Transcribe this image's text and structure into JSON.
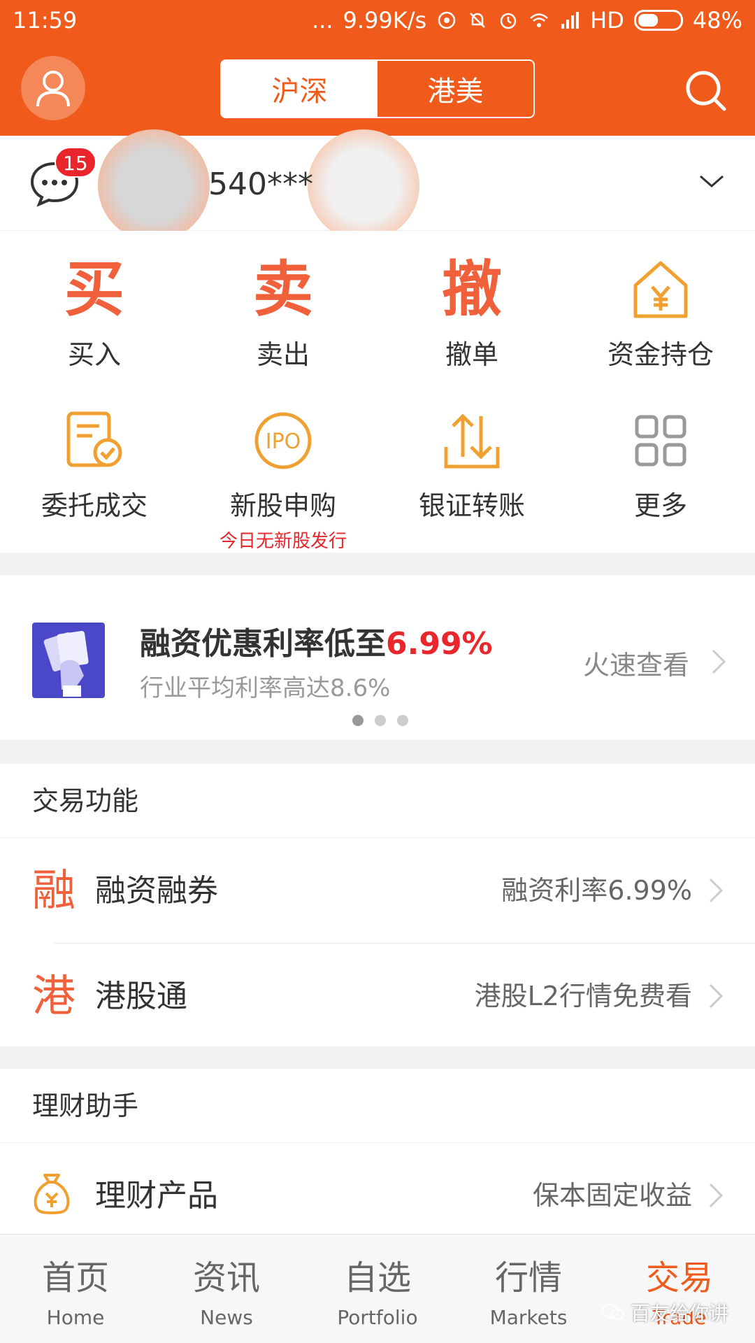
{
  "status_bar": {
    "time": "11:59",
    "dots": "...",
    "network_speed": "9.99K/s",
    "hd": "HD",
    "battery": "48%",
    "battery_level": 0.48
  },
  "header": {
    "tabs": [
      {
        "label": "沪深",
        "active": true
      },
      {
        "label": "港美",
        "active": false
      }
    ]
  },
  "account": {
    "message_badge": "15",
    "account_number": "540***"
  },
  "quick_actions": [
    {
      "glyph": "买",
      "label": "买入"
    },
    {
      "glyph": "卖",
      "label": "卖出"
    },
    {
      "glyph": "撤",
      "label": "撤单"
    },
    {
      "icon": "money-house-icon",
      "label": "资金持仓"
    },
    {
      "icon": "order-document-icon",
      "label": "委托成交"
    },
    {
      "icon": "ipo-icon",
      "icon_text": "IPO",
      "label": "新股申购",
      "sub": "今日无新股发行"
    },
    {
      "icon": "transfer-arrows-icon",
      "label": "银证转账"
    },
    {
      "icon": "grid-more-icon",
      "label": "更多"
    }
  ],
  "banner": {
    "title_prefix": "融资优惠利率低至",
    "title_highlight": "6.99%",
    "subtitle": "行业平均利率高达8.6%",
    "link": "火速查看",
    "page_count": 3,
    "active_page": 1
  },
  "trade_section": {
    "title": "交易功能",
    "rows": [
      {
        "glyph": "融",
        "name": "融资融券",
        "desc": "融资利率6.99%"
      },
      {
        "glyph": "港",
        "name": "港股通",
        "desc": "港股L2行情免费看"
      }
    ]
  },
  "wealth_section": {
    "title": "理财助手",
    "rows": [
      {
        "icon": "money-bag-icon",
        "name": "理财产品",
        "desc": "保本固定收益"
      }
    ]
  },
  "bottom_nav": [
    {
      "cn": "首页",
      "en": "Home",
      "active": false
    },
    {
      "cn": "资讯",
      "en": "News",
      "active": false
    },
    {
      "cn": "自选",
      "en": "Portfolio",
      "active": false
    },
    {
      "cn": "行情",
      "en": "Markets",
      "active": false
    },
    {
      "cn": "交易",
      "en": "Trade",
      "active": true
    }
  ],
  "watermark": "百友给你讲",
  "colors": {
    "brand_orange": "#f05a1a",
    "accent_red": "#e8262c",
    "icon_orange": "#f0a030"
  }
}
